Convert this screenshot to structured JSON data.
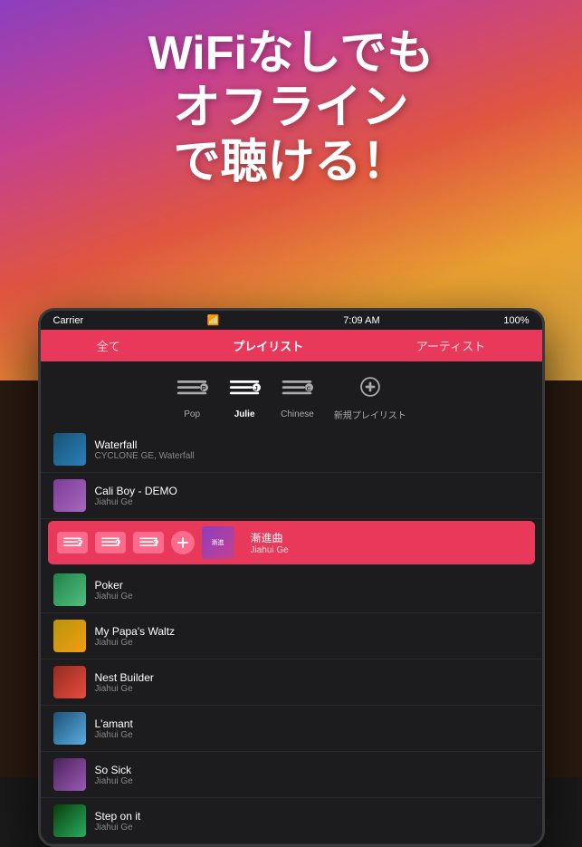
{
  "headline": {
    "line1": "WiFiなしでも",
    "line2": "オフライン",
    "line3": "で聴ける！"
  },
  "status_bar": {
    "carrier": "Carrier",
    "wifi_icon": "wifi",
    "time": "7:09 AM",
    "battery": "100%"
  },
  "tabs": [
    {
      "label": "全て",
      "active": false
    },
    {
      "label": "プレイリスト",
      "active": true
    },
    {
      "label": "アーティスト",
      "active": false
    }
  ],
  "playlists": [
    {
      "label": "Pop",
      "active": false
    },
    {
      "label": "Julie",
      "active": true
    },
    {
      "label": "Chinese",
      "active": false
    },
    {
      "label": "新規プレイリスト",
      "active": false
    }
  ],
  "songs": [
    {
      "title": "Waterfall",
      "artist": "CYCLONE GE, Waterfall",
      "art_class": "album-art-1",
      "active": false
    },
    {
      "title": "Cali Boy - DEMO",
      "artist": "Jiahui Ge",
      "art_class": "album-art-2",
      "active": false
    },
    {
      "title": "漸進曲",
      "artist": "Jiahui Ge",
      "art_class": "active-album",
      "active": true,
      "is_highlight": true
    },
    {
      "title": "Poker",
      "artist": "Jiahui Ge",
      "art_class": "album-art-3",
      "active": false
    },
    {
      "title": "My Papa's Waltz",
      "artist": "Jiahui Ge",
      "art_class": "album-art-4",
      "active": false
    },
    {
      "title": "Nest Builder",
      "artist": "Jiahui Ge",
      "art_class": "album-art-5",
      "active": false
    },
    {
      "title": "L'amant",
      "artist": "Jiahui Ge",
      "art_class": "album-art-6",
      "active": false
    },
    {
      "title": "So Sick",
      "artist": "Jiahui Ge",
      "art_class": "album-art-7",
      "active": false
    },
    {
      "title": "Step on it",
      "artist": "Jiahui Ge",
      "art_class": "album-art-8",
      "active": false
    }
  ]
}
